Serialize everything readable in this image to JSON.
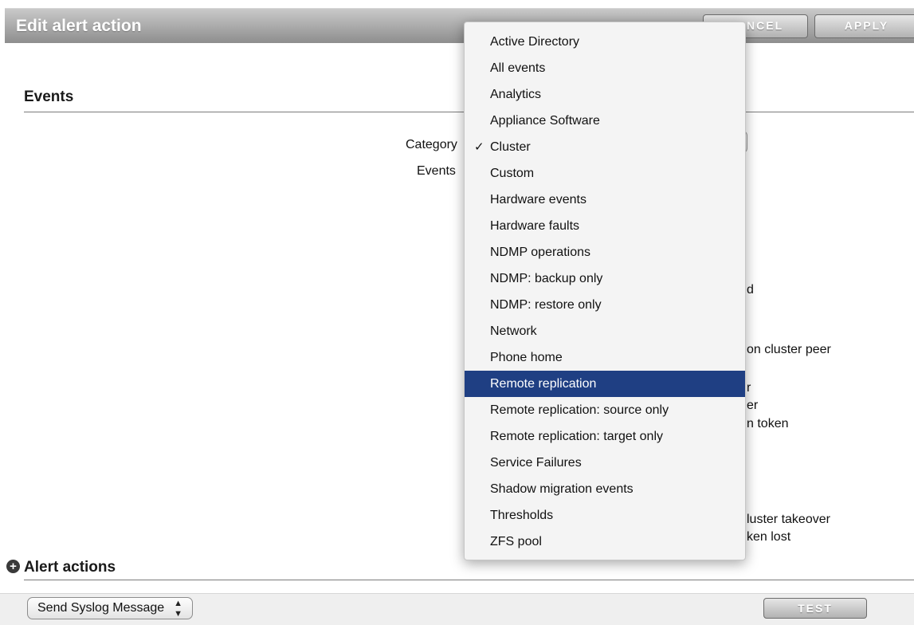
{
  "header": {
    "title": "Edit alert action",
    "cancel_label": "CANCEL",
    "apply_label": "APPLY"
  },
  "events_section": {
    "title": "Events",
    "category_label": "Category",
    "events_label": "Events",
    "visible_event_fragments": [
      "d",
      "on cluster peer",
      "r",
      "er",
      "n token",
      "luster takeover",
      "ken lost"
    ]
  },
  "dropdown": {
    "selected": "Cluster",
    "highlighted": "Remote replication",
    "check_mark": "✓",
    "items": [
      "Active Directory",
      "All events",
      "Analytics",
      "Appliance Software",
      "Cluster",
      "Custom",
      "Hardware events",
      "Hardware faults",
      "NDMP operations",
      "NDMP: backup only",
      "NDMP: restore only",
      "Network",
      "Phone home",
      "Remote replication",
      "Remote replication: source only",
      "Remote replication: target only",
      "Service Failures",
      "Shadow migration events",
      "Thresholds",
      "ZFS pool"
    ]
  },
  "alert_actions": {
    "title": "Alert actions",
    "icon": "plus-circle-icon",
    "action_select_value": "Send Syslog Message",
    "test_label": "TEST"
  },
  "colors": {
    "highlight": "#1f3f83",
    "header_gradient_top": "#c9c9c9",
    "header_gradient_bottom": "#8e8e8e"
  }
}
